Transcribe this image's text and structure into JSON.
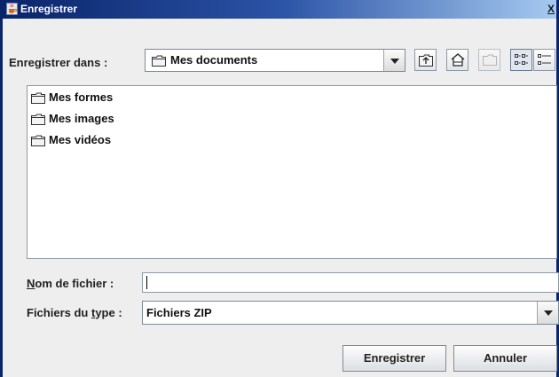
{
  "window": {
    "title": "Enregistrer",
    "close_glyph": "X"
  },
  "save_in": {
    "label_pre": "Enre",
    "label_mnemonic": "g",
    "label_post": "istrer dans :",
    "selected": "Mes documents",
    "icon": "folder-icon"
  },
  "toolbar": [
    {
      "name": "up-one-level-button",
      "icon": "up-folder-icon"
    },
    {
      "name": "home-button",
      "icon": "home-icon"
    },
    {
      "name": "new-folder-button",
      "icon": "new-folder-icon",
      "disabled": true
    },
    {
      "name": "list-view-button",
      "icon": "list-view-icon",
      "pressed": true
    },
    {
      "name": "details-view-button",
      "icon": "details-view-icon"
    }
  ],
  "files": [
    {
      "name": "Mes formes",
      "icon": "folder-icon"
    },
    {
      "name": "Mes images",
      "icon": "folder-icon"
    },
    {
      "name": "Mes vidéos",
      "icon": "folder-icon"
    }
  ],
  "filename": {
    "label_mnemonic": "N",
    "label_post": "om de fichier :",
    "value": ""
  },
  "filetype": {
    "label_pre": "Fichiers du ",
    "label_mnemonic": "t",
    "label_post": "ype :",
    "selected": "Fichiers ZIP"
  },
  "buttons": {
    "save": "Enregistrer",
    "cancel": "Annuler"
  },
  "colors": {
    "title_start": "#0a246a",
    "title_end": "#a6caf0",
    "dialog_bg": "#eeeeee"
  }
}
